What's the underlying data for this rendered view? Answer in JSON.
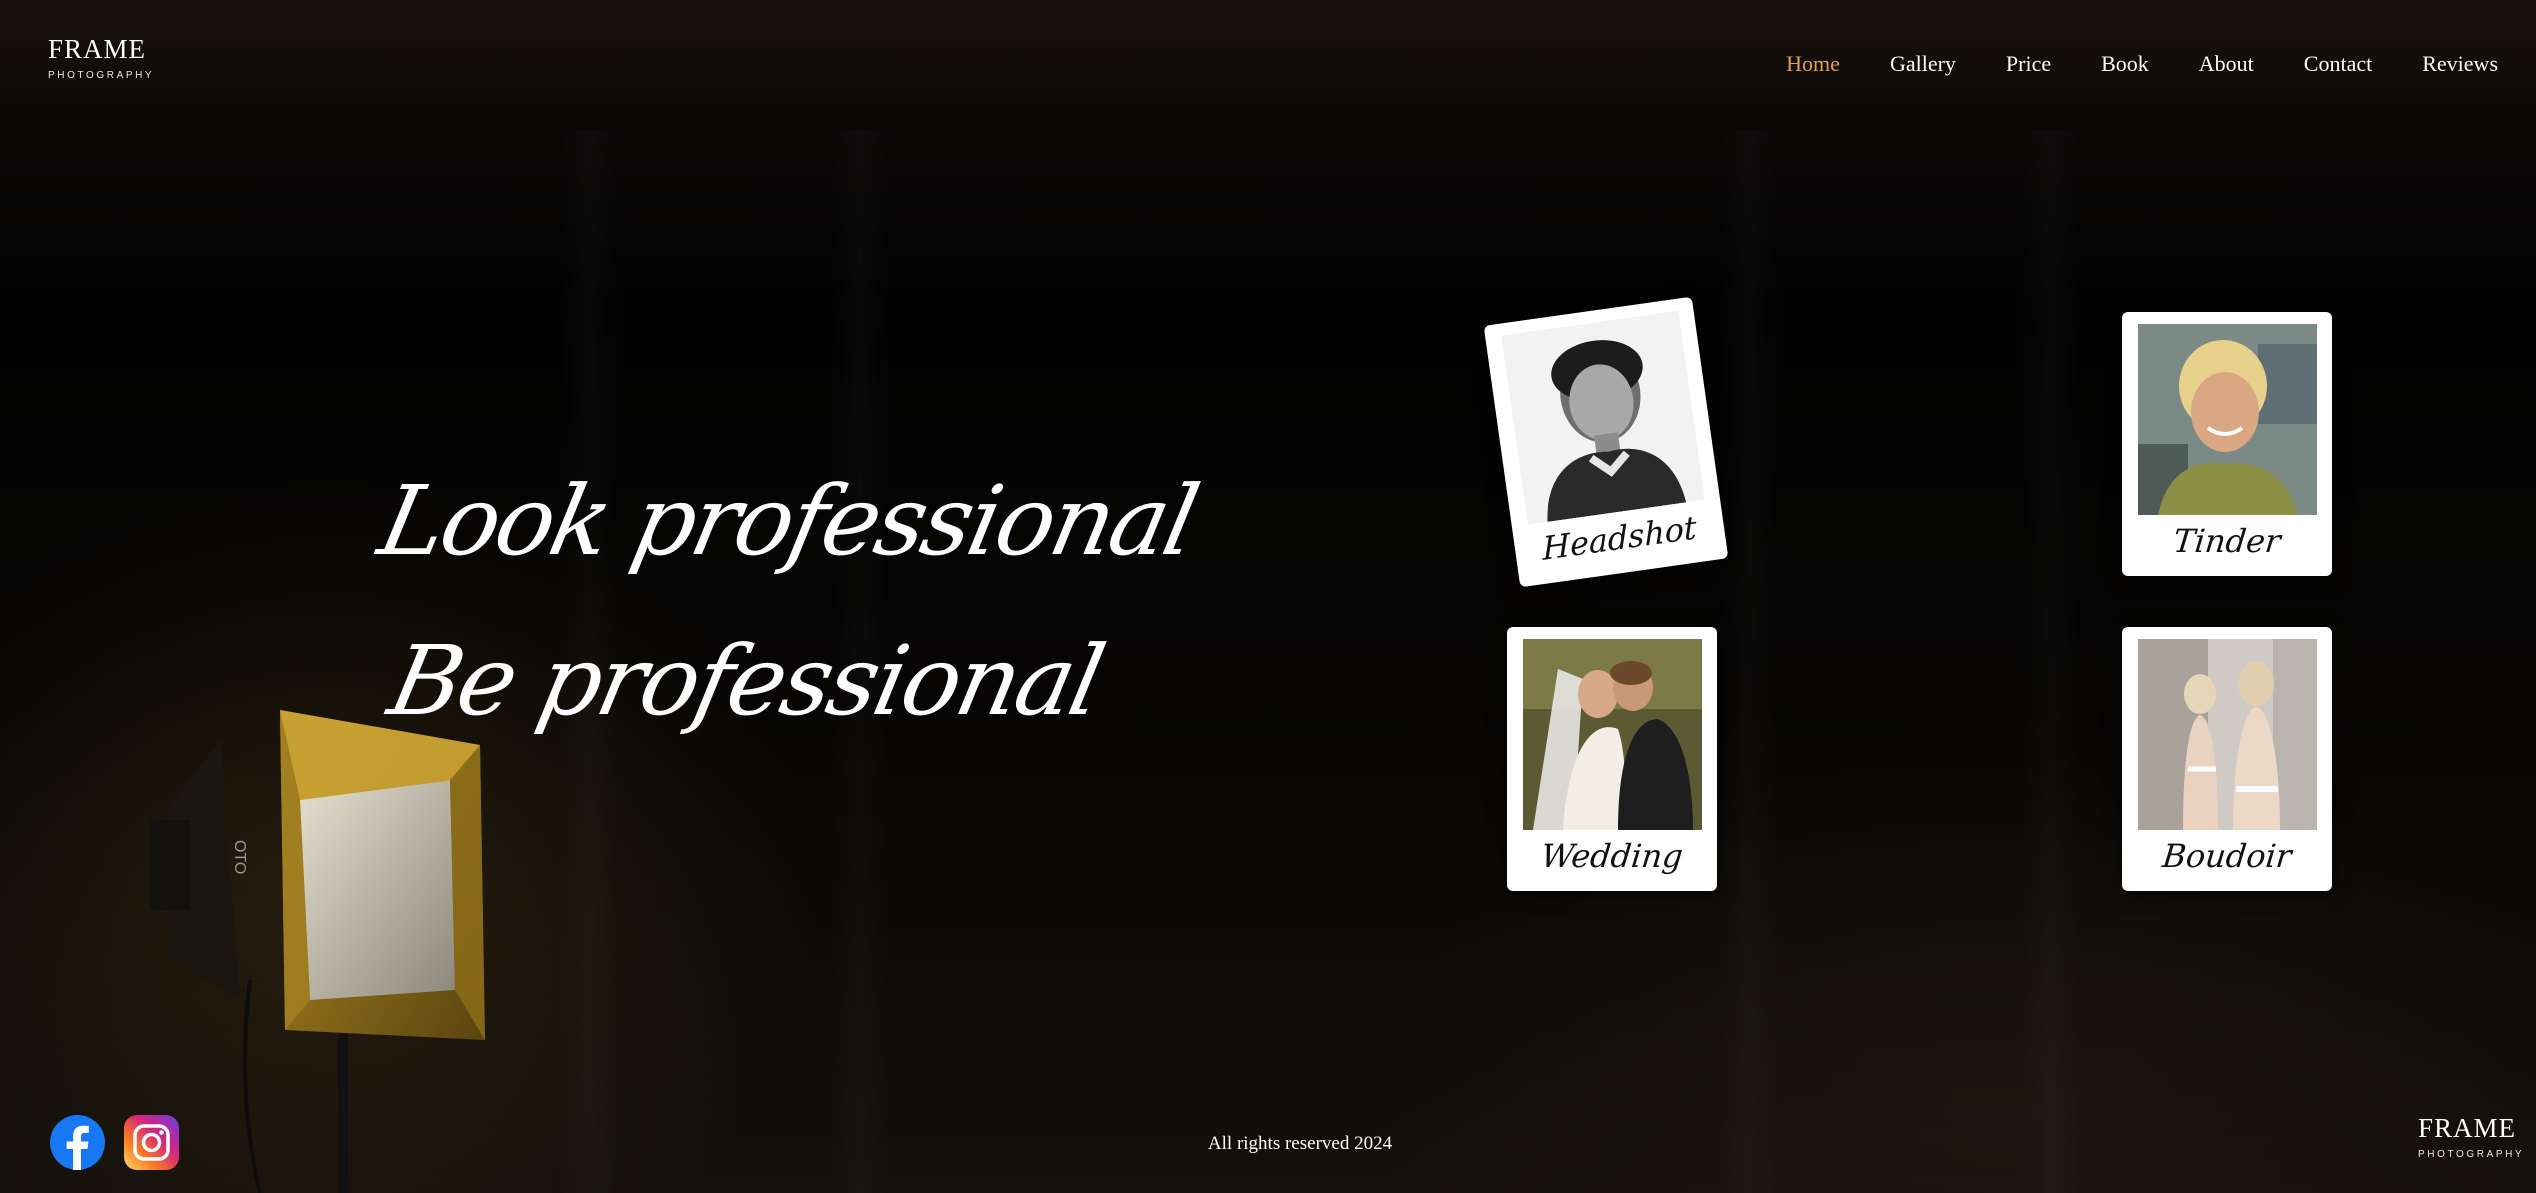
{
  "header": {
    "logo_main": "FRAME",
    "logo_sub": "PHOTOGRAPHY",
    "nav": [
      {
        "label": "Home",
        "active": true
      },
      {
        "label": "Gallery",
        "active": false
      },
      {
        "label": "Price",
        "active": false
      },
      {
        "label": "Book",
        "active": false
      },
      {
        "label": "About",
        "active": false
      },
      {
        "label": "Contact",
        "active": false
      },
      {
        "label": "Reviews",
        "active": false
      }
    ]
  },
  "hero": {
    "line1": "Look professional",
    "line2": "Be professional"
  },
  "cards": [
    {
      "caption": "Headshot",
      "photo": "headshot-photo"
    },
    {
      "caption": "Tinder",
      "photo": "tinder-photo"
    },
    {
      "caption": "Wedding",
      "photo": "wedding-photo"
    },
    {
      "caption": "Boudoir",
      "photo": "boudoir-photo"
    }
  ],
  "footer": {
    "copyright": "All rights reserved 2024",
    "logo_main": "FRAME",
    "logo_sub": "PHOTOGRAPHY",
    "social": [
      {
        "icon": "facebook-icon"
      },
      {
        "icon": "instagram-icon"
      }
    ]
  },
  "colors": {
    "accent": "#e0a055",
    "background": "#050403",
    "text": "#ffffff",
    "facebook": "#1877f2"
  }
}
